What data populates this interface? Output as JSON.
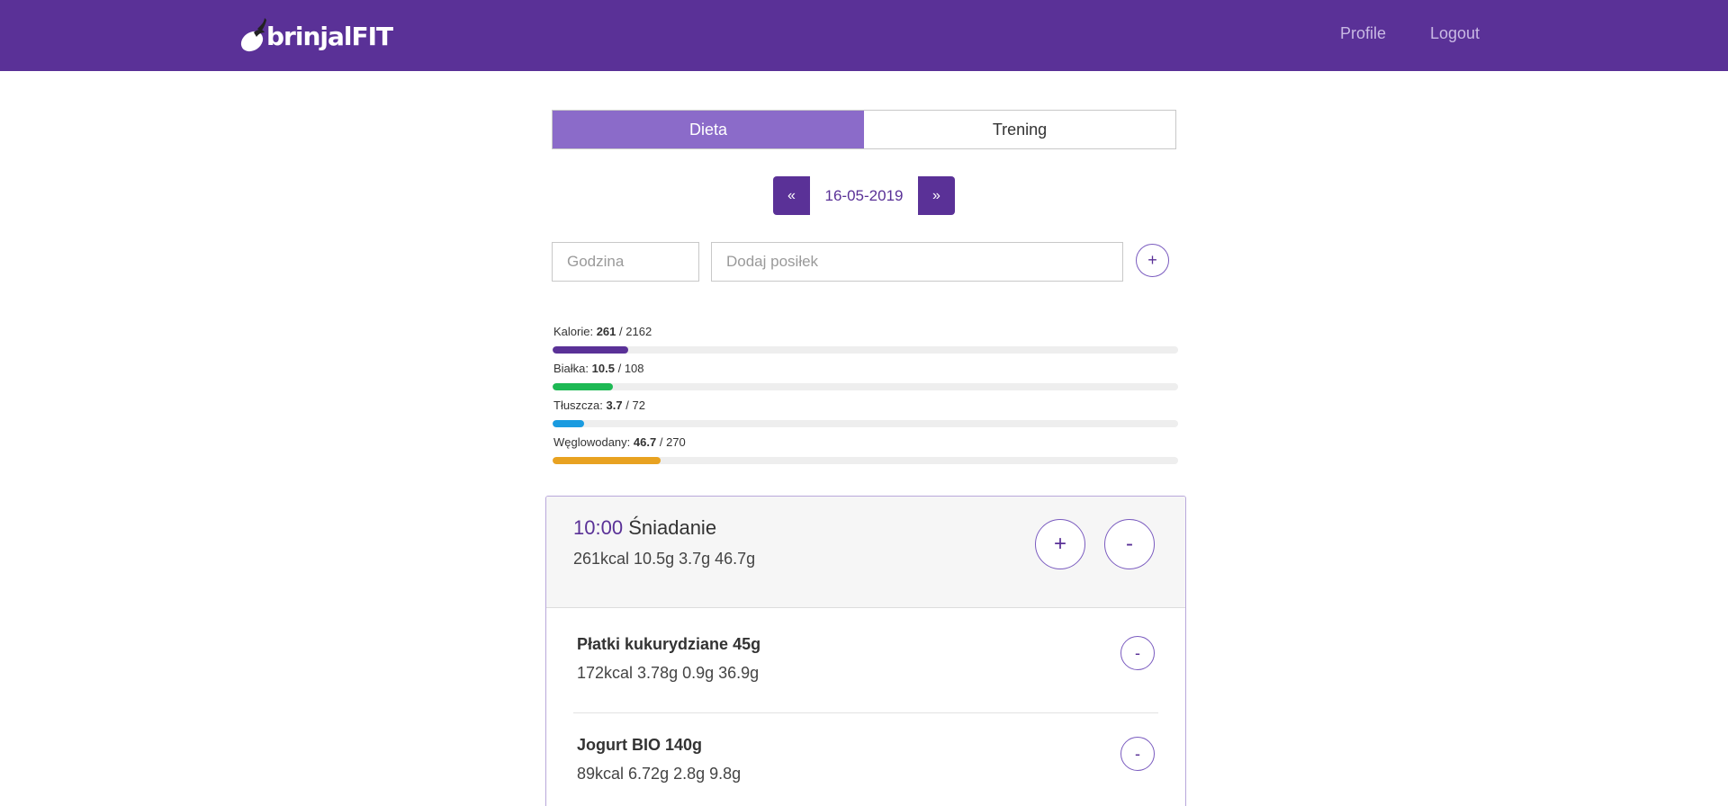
{
  "nav": {
    "brand_text": "brinjalFIT",
    "links": [
      {
        "label": "Profile"
      },
      {
        "label": "Logout"
      }
    ]
  },
  "tabs": [
    {
      "label": "Dieta",
      "active": true
    },
    {
      "label": "Trening",
      "active": false
    }
  ],
  "date_nav": {
    "prev_label": "«",
    "date": "16-05-2019",
    "next_label": "»"
  },
  "add_meal": {
    "hour_placeholder": "Godzina",
    "meal_placeholder": "Dodaj posiłek",
    "add_label": "+"
  },
  "macros": [
    {
      "label": "Kalorie:",
      "value": "261",
      "target": "/ 2162",
      "fraction": 0.121,
      "color": "#5a3197"
    },
    {
      "label": "Białka:",
      "value": "10.5",
      "target": "/ 108",
      "fraction": 0.097,
      "color": "#1db954"
    },
    {
      "label": "Tłuszcza:",
      "value": "3.7",
      "target": "/ 72",
      "fraction": 0.051,
      "color": "#1a9be0"
    },
    {
      "label": "Węglowodany:",
      "value": "46.7",
      "target": "/ 270",
      "fraction": 0.173,
      "color": "#e8a221"
    }
  ],
  "meal": {
    "time": "10:00",
    "name": "Śniadanie",
    "summary": "261kcal 10.5g 3.7g 46.7g",
    "add_label": "+",
    "remove_label": "-",
    "items": [
      {
        "name": "Płatki kukurydziane 45g",
        "macros": "172kcal 3.78g 0.9g 36.9g",
        "remove_label": "-"
      },
      {
        "name": "Jogurt BIO 140g",
        "macros": "89kcal 6.72g 2.8g 9.8g",
        "remove_label": "-"
      }
    ]
  },
  "colors": {
    "brand": "#5a3197",
    "tab_active": "#8b6bc9"
  }
}
